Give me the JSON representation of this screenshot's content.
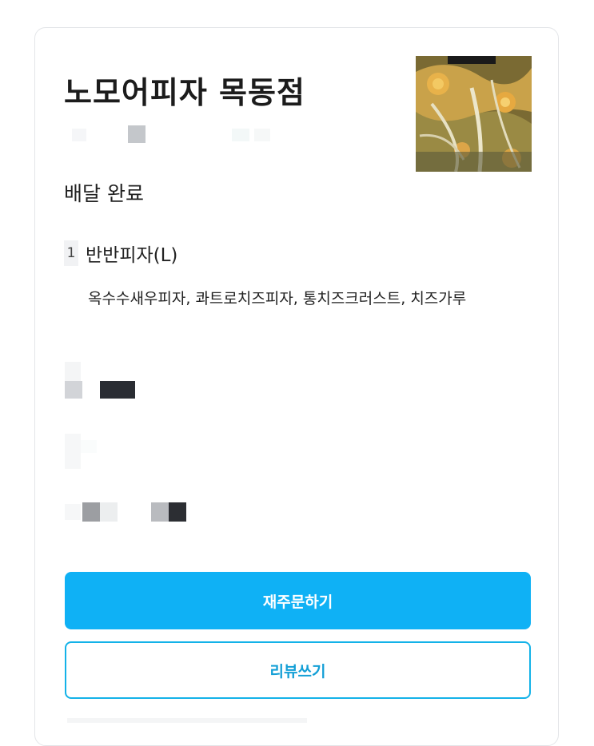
{
  "order": {
    "store_name": "노모어피자 목동점",
    "status": "배달 완료",
    "item": {
      "quantity": "1",
      "name": "반반피자(L)",
      "options": "옥수수새우피자, 콰트로치즈피자, 통치즈크러스트, 치즈가루"
    }
  },
  "actions": {
    "reorder_label": "재주문하기",
    "review_label": "리뷰쓰기"
  },
  "colors": {
    "primary": "#0fb1f5",
    "outline": "#13b2e8"
  }
}
